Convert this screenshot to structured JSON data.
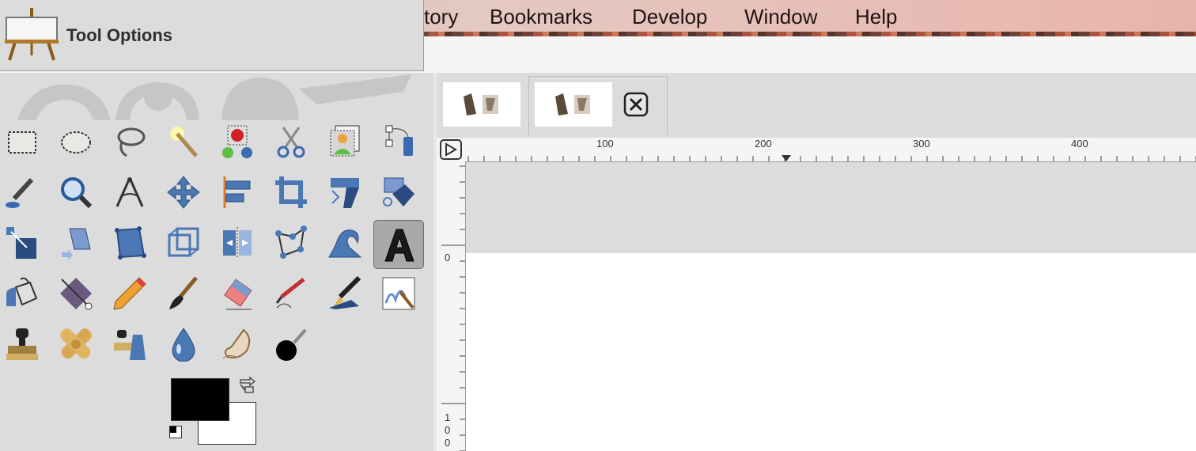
{
  "menubar": {
    "items": [
      {
        "label": "tory"
      },
      {
        "label": "Bookmarks"
      },
      {
        "label": "Develop"
      },
      {
        "label": "Window"
      },
      {
        "label": "Help"
      }
    ]
  },
  "tool_options": {
    "title": "Tool Options"
  },
  "toolbox": {
    "tools": [
      {
        "icon": "rect-select-icon"
      },
      {
        "icon": "ellipse-select-icon"
      },
      {
        "icon": "free-select-icon"
      },
      {
        "icon": "fuzzy-select-icon"
      },
      {
        "icon": "select-by-color-icon"
      },
      {
        "icon": "scissors-select-icon"
      },
      {
        "icon": "foreground-select-icon"
      },
      {
        "icon": "paths-icon"
      },
      {
        "icon": "color-picker-icon"
      },
      {
        "icon": "zoom-icon"
      },
      {
        "icon": "measure-icon"
      },
      {
        "icon": "move-icon"
      },
      {
        "icon": "align-icon"
      },
      {
        "icon": "crop-icon"
      },
      {
        "icon": "rotate-icon"
      },
      {
        "icon": "scale-icon"
      },
      {
        "icon": "shear-icon"
      },
      {
        "icon": "perspective-icon"
      },
      {
        "icon": "unified-transform-icon"
      },
      {
        "icon": "3d-transform-icon"
      },
      {
        "icon": "flip-icon"
      },
      {
        "icon": "cage-transform-icon"
      },
      {
        "icon": "warp-transform-icon"
      },
      {
        "icon": "text-icon"
      },
      {
        "icon": "bucket-fill-icon"
      },
      {
        "icon": "gradient-icon"
      },
      {
        "icon": "pencil-icon"
      },
      {
        "icon": "paintbrush-icon"
      },
      {
        "icon": "eraser-icon"
      },
      {
        "icon": "airbrush-icon"
      },
      {
        "icon": "ink-icon"
      },
      {
        "icon": "mypaint-brush-icon"
      },
      {
        "icon": "clone-icon"
      },
      {
        "icon": "heal-icon"
      },
      {
        "icon": "perspective-clone-icon"
      },
      {
        "icon": "blur-sharpen-icon"
      },
      {
        "icon": "smudge-icon"
      },
      {
        "icon": "dodge-burn-icon"
      }
    ],
    "active_tool": "text-icon",
    "foreground_color": "#000000",
    "background_color": "#ffffff"
  },
  "image_tabs": [
    {
      "icon": "image-thumbnail-icon"
    },
    {
      "icon": "image-thumbnail-icon"
    }
  ],
  "ruler": {
    "h_labels": [
      "100",
      "200",
      "300",
      "400"
    ],
    "v_labels": [
      "0",
      "1",
      "0",
      "0"
    ]
  },
  "colors": {
    "accent": "#4a78b5",
    "menubar": "#e4c9c2"
  }
}
